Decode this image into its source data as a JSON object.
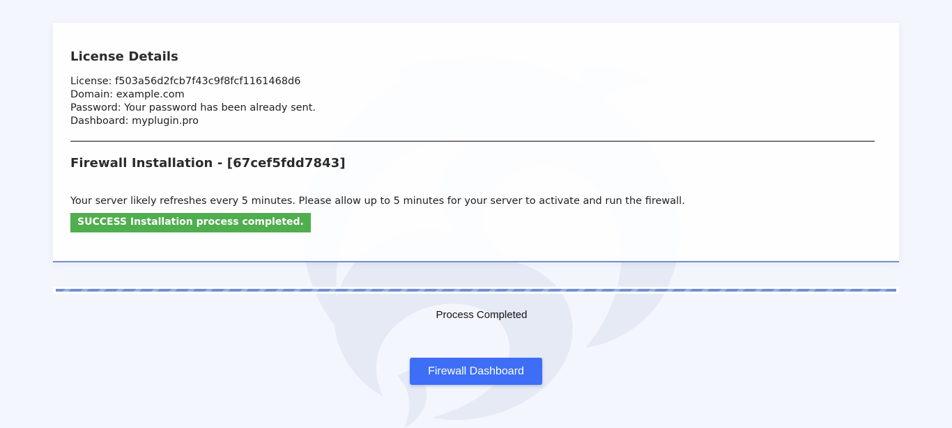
{
  "license": {
    "heading": "License Details",
    "lines": [
      "License: f503a56d2fcb7f43c9f8fcf1161468d6",
      "Domain: example.com",
      "Password: Your password has been already sent.",
      "Dashboard: myplugin.pro"
    ]
  },
  "firewall": {
    "heading": "Firewall Installation - [67cef5fdd7843]",
    "info": "Your server likely refreshes every 5 minutes. Please allow up to 5 minutes for your server to activate and run the firewall.",
    "status_badge": "SUCCESS Installation process completed.",
    "status_color": "#4fae4d"
  },
  "progress": {
    "value_percent": 100,
    "status_text": "Process Completed",
    "color": "#6f8fce"
  },
  "actions": {
    "dashboard_button": "Firewall Dashboard",
    "button_color": "#3d6ef5"
  },
  "background": {
    "watermark_icon": "dragon-logo-icon",
    "color": "#f4f6fe"
  }
}
